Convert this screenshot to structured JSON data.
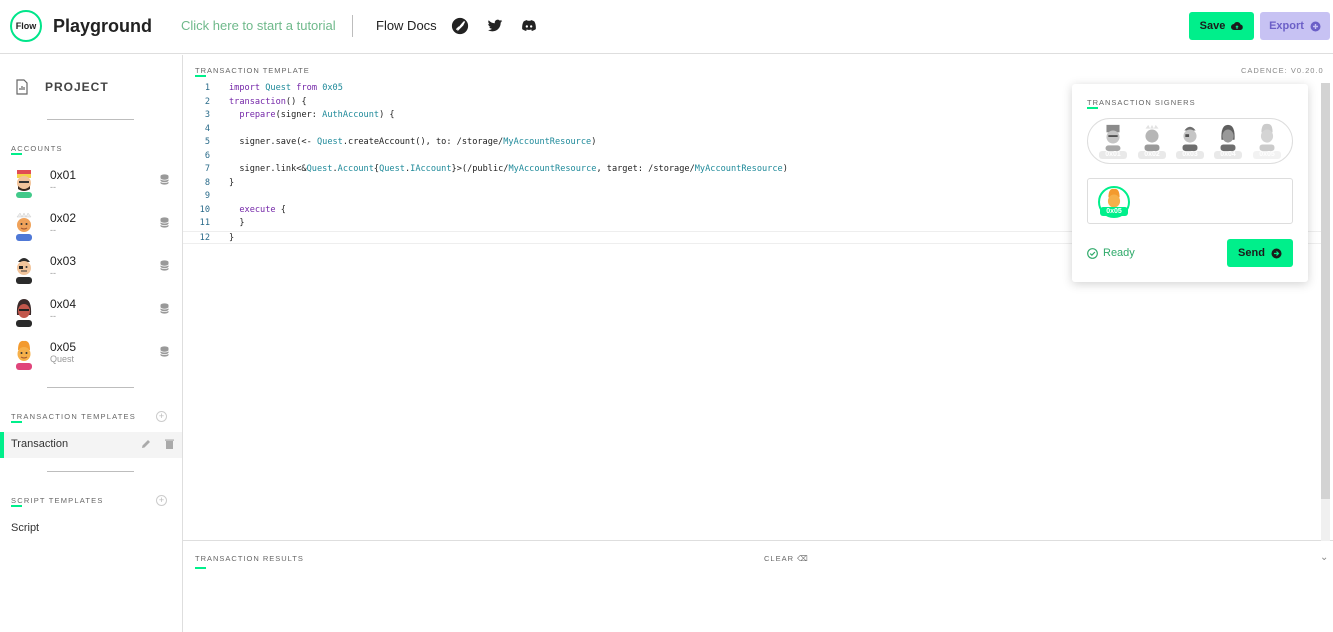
{
  "header": {
    "logo_text": "Flow",
    "app_title": "Playground",
    "tutorial_link": "Click here to start a tutorial",
    "docs_link": "Flow Docs",
    "social_icons": [
      "rocket-icon",
      "twitter-icon",
      "discord-icon"
    ],
    "save_label": "Save",
    "export_label": "Export"
  },
  "sidebar": {
    "project_label": "PROJECT",
    "accounts_title": "ACCOUNTS",
    "accounts": [
      {
        "address": "0x01",
        "sub": "--"
      },
      {
        "address": "0x02",
        "sub": "--"
      },
      {
        "address": "0x03",
        "sub": "--"
      },
      {
        "address": "0x04",
        "sub": "--"
      },
      {
        "address": "0x05",
        "sub": "Quest"
      }
    ],
    "transaction_templates_title": "TRANSACTION TEMPLATES",
    "transaction_templates": [
      {
        "label": "Transaction",
        "active": true
      }
    ],
    "script_templates_title": "SCRIPT TEMPLATES",
    "script_templates": [
      {
        "label": "Script"
      }
    ]
  },
  "editor": {
    "title": "TRANSACTION TEMPLATE",
    "cadence_version": "CADENCE: V0.20.0",
    "current_line": 12,
    "lines": [
      "import Quest from 0x05",
      "transaction() {",
      "  prepare(signer: AuthAccount) {",
      "",
      "  signer.save(<- Quest.createAccount(), to: /storage/MyAccountResource)",
      "",
      "  signer.link<&Quest.Account{Quest.IAccount}>(/public/MyAccountResource, target: /storage/MyAccountResource)",
      "}",
      "",
      "  execute {",
      "  }",
      "}"
    ]
  },
  "signers": {
    "title": "TRANSACTION SIGNERS",
    "available": [
      "0x01",
      "0x02",
      "0x03",
      "0x04",
      "0x05"
    ],
    "selected": [
      "0x05"
    ],
    "status": "Ready",
    "send_label": "Send"
  },
  "results": {
    "title": "TRANSACTION RESULTS",
    "clear_label": "CLEAR"
  },
  "colors": {
    "accent": "#00ef8b",
    "export_bg": "#c7c2f3",
    "keyword": "#7426a8",
    "type": "#1f8a9a"
  }
}
